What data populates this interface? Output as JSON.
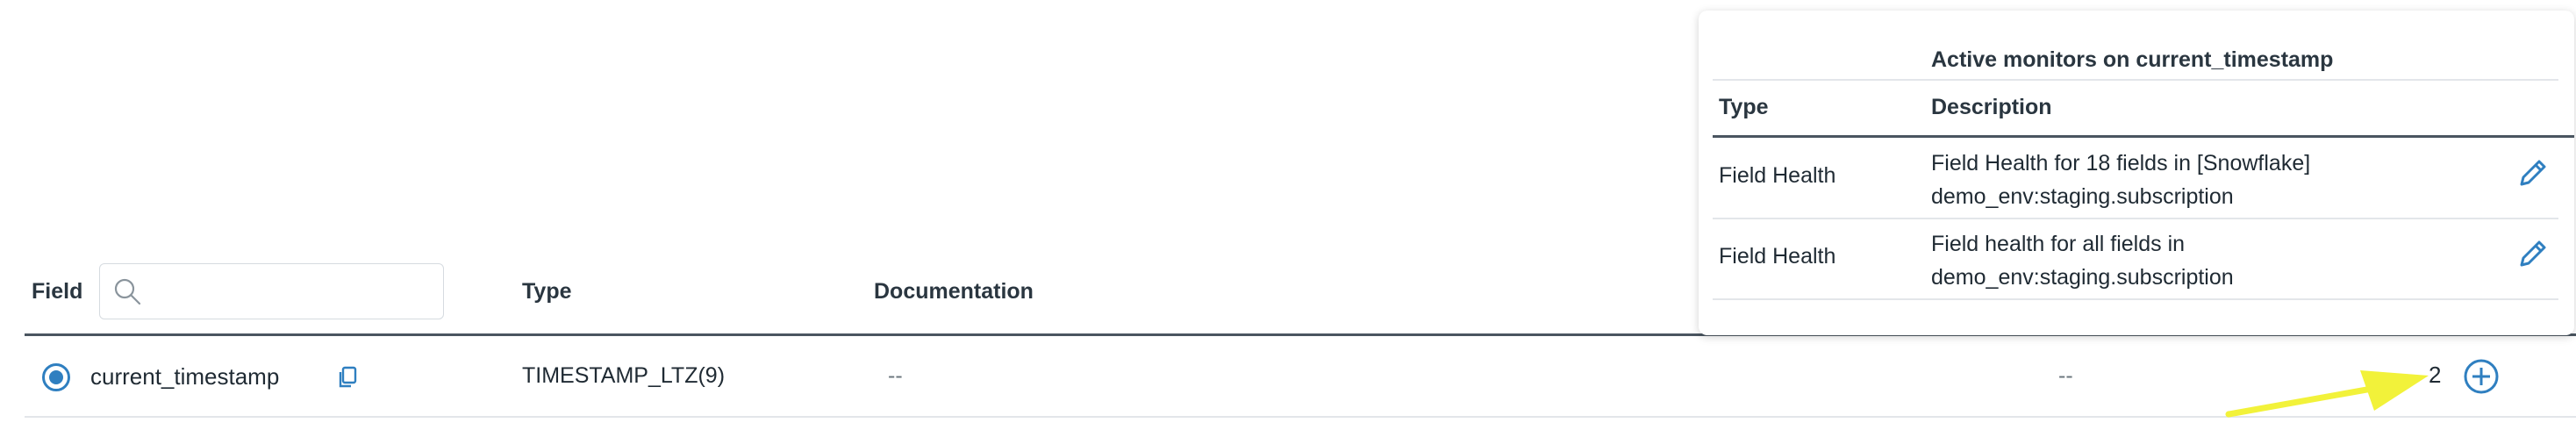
{
  "table": {
    "headers": {
      "field": "Field",
      "type": "Type",
      "documentation": "Documentation"
    },
    "search": {
      "placeholder": "",
      "value": ""
    },
    "rows": [
      {
        "selected": true,
        "name": "current_timestamp",
        "type": "TIMESTAMP_LTZ(9)",
        "documentation": "--",
        "column5": "--",
        "monitor_count": "2"
      }
    ]
  },
  "popover": {
    "title": "Active monitors on current_timestamp",
    "headers": {
      "type": "Type",
      "description": "Description"
    },
    "monitors": [
      {
        "type": "Field Health",
        "description_line1": "Field Health for 18 fields in [Snowflake]",
        "description_line2": "demo_env:staging.subscription"
      },
      {
        "type": "Field Health",
        "description_line1": "Field health for all fields in",
        "description_line2": "demo_env:staging.subscription"
      }
    ]
  },
  "colors": {
    "accent": "#2f7fc0",
    "annotation_arrow": "#f2f23a",
    "header_rule": "#4a5560"
  },
  "icons": [
    "search-icon",
    "copy-icon",
    "add-circle-icon",
    "edit-pencil-icon",
    "arrow-annotation"
  ]
}
